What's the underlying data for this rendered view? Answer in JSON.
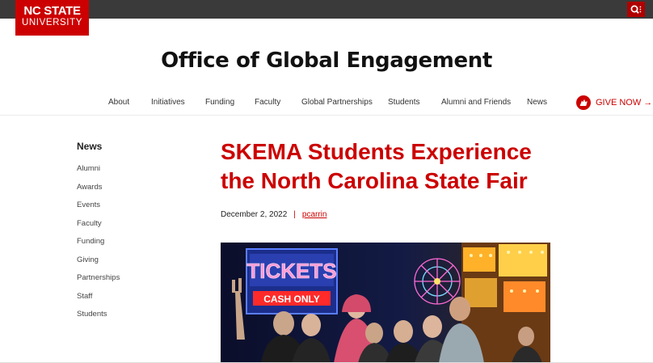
{
  "header": {
    "logo_line1": "NC STATE",
    "logo_line2": "UNIVERSITY",
    "search_icon": "search-icon",
    "site_title": "Office of Global Engagement"
  },
  "nav": {
    "items": [
      "About",
      "Initiatives",
      "Funding",
      "Faculty",
      "Global Partnerships",
      "Students",
      "Alumni and Friends",
      "News"
    ],
    "give_label": "GIVE NOW →",
    "give_icon": "wolf-icon"
  },
  "sidebar": {
    "title": "News",
    "items": [
      "Alumni",
      "Awards",
      "Events",
      "Faculty",
      "Funding",
      "Giving",
      "Partnerships",
      "Staff",
      "Students"
    ]
  },
  "article": {
    "title": "SKEMA Students Experience the North Carolina State Fair",
    "date": "December 2, 2022",
    "separator": "|",
    "author": "pcarrin",
    "photo_sign_text": "TICKETS",
    "photo_sign_sub": "CASH ONLY"
  },
  "colors": {
    "brand_red": "#cc0000",
    "topbar": "#3a3a3a"
  }
}
